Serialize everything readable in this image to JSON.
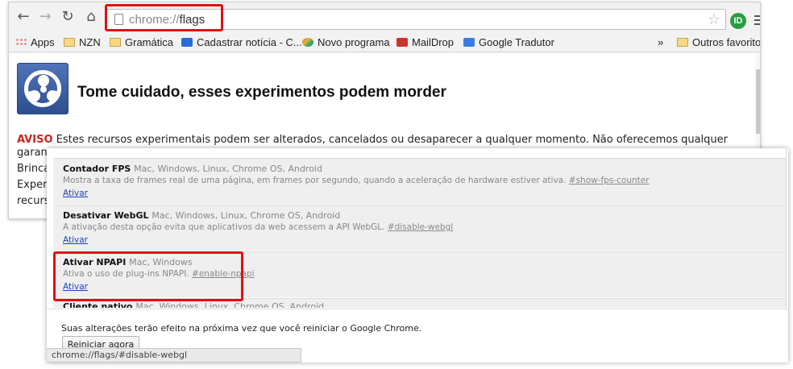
{
  "browser": {
    "nav": {
      "back": "←",
      "forward": "→",
      "reload": "↻",
      "home": "⌂"
    },
    "omnibox": {
      "scheme": "chrome://",
      "path": "flags"
    },
    "extension_badge": "ID",
    "bookmarks": [
      {
        "label": "Apps",
        "icon": "apps-grid-icon"
      },
      {
        "label": "NZN",
        "icon": "folder-icon"
      },
      {
        "label": "Gramática",
        "icon": "folder-icon"
      },
      {
        "label": "Cadastrar notícia - C...",
        "icon": "site-icon"
      },
      {
        "label": "Novo programa",
        "icon": "site-icon"
      },
      {
        "label": "MailDrop",
        "icon": "maildrop-icon"
      },
      {
        "label": "Google Tradutor",
        "icon": "google-translate-icon"
      }
    ],
    "bookmarks_overflow": "»",
    "other_bookmarks": "Outros favoritos"
  },
  "flags_page": {
    "headline": "Tome cuidado, esses experimentos podem morder",
    "warning_label": "AVISO",
    "warning_text": "Estes recursos experimentais podem ser alterados, cancelados ou desaparecer a qualquer momento. Não oferecemos qualquer",
    "cut_lines": [
      "garan",
      "Brinca",
      "Exper",
      "recurs"
    ]
  },
  "flags_list": [
    {
      "name": "Contador FPS",
      "platforms": "Mac, Windows, Linux, Chrome OS, Android",
      "description": "Mostra a taxa de frames real de uma página, em frames por segundo, quando a aceleração de hardware estiver ativa.",
      "anchor": "#show-fps-counter",
      "action": "Ativar"
    },
    {
      "name": "Desativar WebGL",
      "platforms": "Mac, Windows, Linux, Chrome OS, Android",
      "description": "A ativação desta opção evita que aplicativos da web acessem a API WebGL.",
      "anchor": "#disable-webgl",
      "action": "Ativar"
    },
    {
      "name": "Ativar NPAPI",
      "platforms": "Mac, Windows",
      "description": "Ativa o uso de plug-ins NPAPI.",
      "anchor": "#enable-npapi",
      "action": "Ativar"
    }
  ],
  "flag_partial": {
    "name": "Cliente nativo",
    "platforms": "Mac, Windows, Linux, Chrome OS, Android"
  },
  "footer": {
    "message": "Suas alterações terão efeito na próxima vez que você reiniciar o Google Chrome.",
    "restart_button": "Reiniciar agora"
  },
  "status_url": "chrome://flags/#disable-webgl",
  "highlight_color": "#e01010",
  "warning_color": "#c8241c",
  "link_color": "#1a3fbf"
}
